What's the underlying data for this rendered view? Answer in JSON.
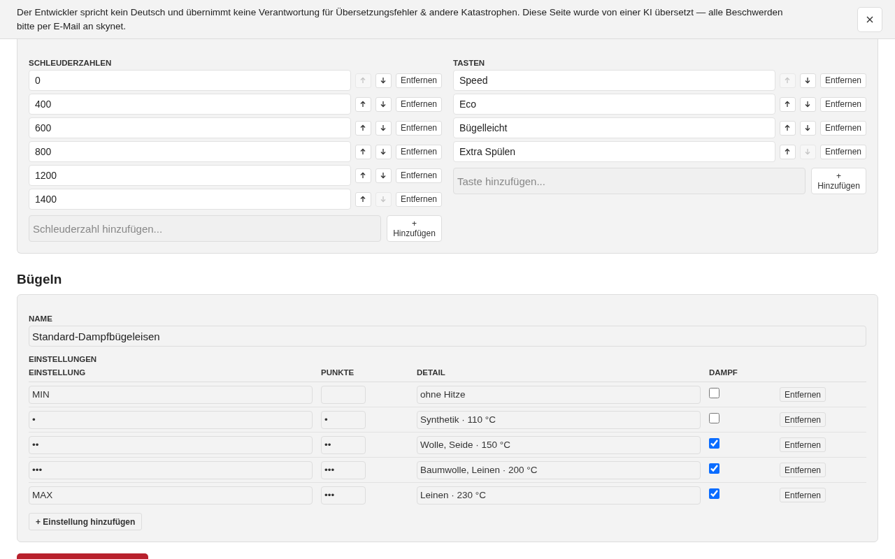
{
  "banner": {
    "text": "Der Entwickler spricht kein Deutsch und übernimmt keine Verantwortung für Übersetzungsfehler & andere Katastrophen. Diese Seite wurde von einer KI übersetzt — alle Beschwerden bitte per E-Mail an skynet."
  },
  "spin_speeds": {
    "label": "SCHLEUDERZAHLEN",
    "items": [
      {
        "value": "0",
        "up_disabled": true,
        "down_disabled": false,
        "remove": "Entfernen"
      },
      {
        "value": "400",
        "up_disabled": false,
        "down_disabled": false,
        "remove": "Entfernen"
      },
      {
        "value": "600",
        "up_disabled": false,
        "down_disabled": false,
        "remove": "Entfernen"
      },
      {
        "value": "800",
        "up_disabled": false,
        "down_disabled": false,
        "remove": "Entfernen"
      },
      {
        "value": "1200",
        "up_disabled": false,
        "down_disabled": false,
        "remove": "Entfernen"
      },
      {
        "value": "1400",
        "up_disabled": false,
        "down_disabled": true,
        "remove": "Entfernen"
      }
    ],
    "add_placeholder": "Schleuderzahl hinzufügen...",
    "add_plus": "+",
    "add_button": "Hinzufügen"
  },
  "buttons_list": {
    "label": "TASTEN",
    "items": [
      {
        "value": "Speed",
        "up_disabled": true,
        "down_disabled": false,
        "remove": "Entfernen"
      },
      {
        "value": "Eco",
        "up_disabled": false,
        "down_disabled": false,
        "remove": "Entfernen"
      },
      {
        "value": "Bügelleicht",
        "up_disabled": false,
        "down_disabled": false,
        "remove": "Entfernen"
      },
      {
        "value": "Extra Spülen",
        "up_disabled": false,
        "down_disabled": true,
        "remove": "Entfernen"
      }
    ],
    "add_placeholder": "Taste hinzufügen...",
    "add_plus": "+",
    "add_button": "Hinzufügen"
  },
  "ironing": {
    "heading": "Bügeln",
    "name_label": "NAME",
    "name_value": "Standard-Dampfbügeleisen",
    "settings_label": "EINSTELLUNGEN",
    "columns": [
      "EINSTELLUNG",
      "PUNKTE",
      "DETAIL",
      "DAMPF"
    ],
    "rows": [
      {
        "setting": "MIN",
        "detail": "ohne Hitze",
        "steam": false,
        "remove": "Entfernen"
      },
      {
        "setting": "•",
        "points": "•",
        "detail": "Synthetik · 110 °C",
        "steam": false,
        "remove": "Entfernen"
      },
      {
        "setting": "••",
        "points": "••",
        "detail": "Wolle, Seide · 150 °C",
        "steam": true,
        "remove": "Entfernen"
      },
      {
        "setting": "•••",
        "points": "•••",
        "detail": "Baumwolle, Leinen · 200 °C",
        "steam": true,
        "remove": "Entfernen"
      },
      {
        "setting": "MAX",
        "points": "•••",
        "detail": "Leinen · 230 °C",
        "steam": true,
        "remove": "Entfernen"
      }
    ],
    "add_button": "+ Einstellung hinzufügen"
  }
}
